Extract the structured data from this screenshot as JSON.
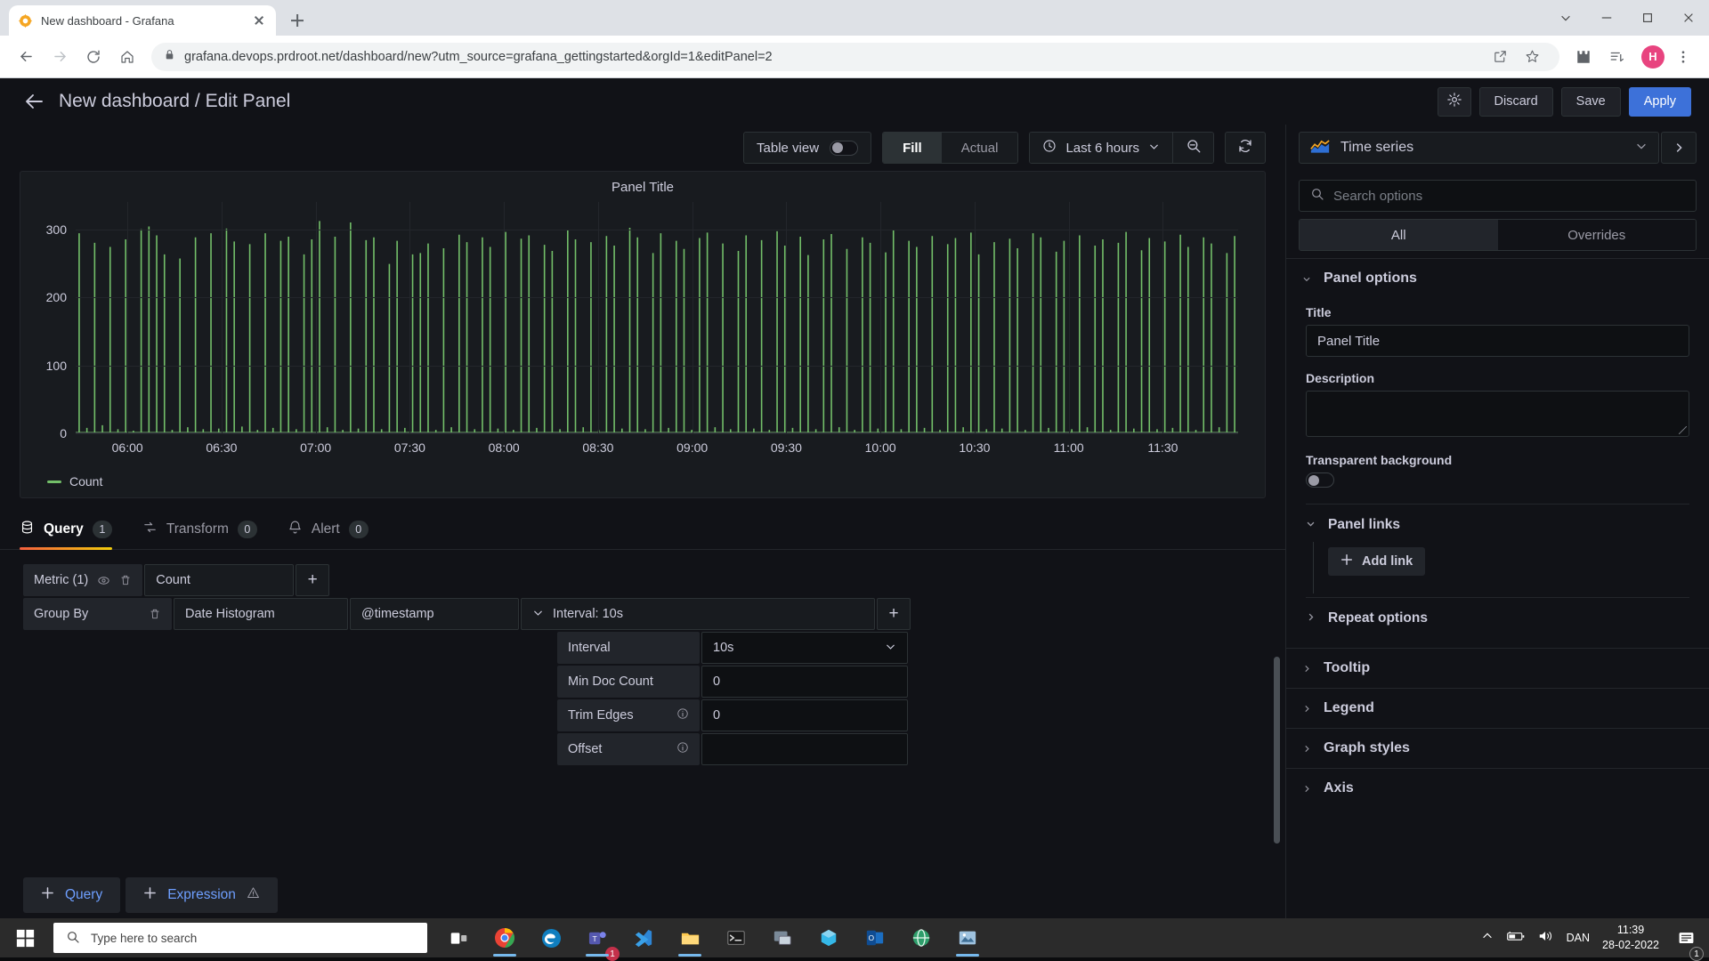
{
  "browser": {
    "tab": {
      "title": "New dashboard - Grafana",
      "favicon": "grafana-logo-icon"
    },
    "url": "grafana.devops.prdroot.net/dashboard/new?utm_source=grafana_gettingstarted&orgId=1&editPanel=2",
    "avatar_initial": "H",
    "new_tab_label": "+"
  },
  "header": {
    "title": "New dashboard / Edit Panel",
    "settings_icon": "gear-icon",
    "discard_label": "Discard",
    "save_label": "Save",
    "apply_label": "Apply"
  },
  "toolbar": {
    "table_view_label": "Table view",
    "table_view_on": false,
    "fill_label": "Fill",
    "actual_label": "Actual",
    "active_sizing": "Fill",
    "time_range": "Last 6 hours",
    "zoom_out_icon": "zoom-out-icon",
    "refresh_icon": "refresh-icon"
  },
  "panel": {
    "title": "Panel Title"
  },
  "chart_data": {
    "type": "bar",
    "title": "Panel Title",
    "xlabel": "",
    "ylabel": "",
    "ylim": [
      0,
      340
    ],
    "yticks": [
      0,
      100,
      200,
      300
    ],
    "xticks": [
      "06:00",
      "06:30",
      "07:00",
      "07:30",
      "08:00",
      "08:30",
      "09:00",
      "09:30",
      "10:00",
      "10:30",
      "11:00",
      "11:30"
    ],
    "grid": true,
    "legend": {
      "position": "bottom",
      "entries": [
        "Count"
      ]
    },
    "series": [
      {
        "name": "Count",
        "color": "#73bf69",
        "values": [
          294,
          8,
          280,
          12,
          274,
          6,
          285,
          4,
          300,
          304,
          291,
          263,
          5,
          257,
          9,
          288,
          6,
          294,
          7,
          301,
          282,
          10,
          278,
          5,
          294,
          8,
          283,
          289,
          6,
          263,
          285,
          312,
          9,
          289,
          5,
          310,
          7,
          284,
          288,
          6,
          249,
          283,
          8,
          263,
          265,
          279,
          5,
          272,
          9,
          292,
          281,
          6,
          288,
          274,
          7,
          296,
          5,
          286,
          291,
          8,
          277,
          268,
          6,
          299,
          285,
          9,
          281,
          5,
          290,
          276,
          7,
          302,
          288,
          6,
          265,
          294,
          8,
          283,
          271,
          5,
          287,
          295,
          9,
          279,
          6,
          268,
          291,
          7,
          284,
          5,
          297,
          276,
          8,
          289,
          262,
          6,
          285,
          293,
          9,
          271,
          5,
          288,
          280,
          7,
          266,
          299,
          6,
          283,
          274,
          8,
          290,
          5,
          278,
          287,
          9,
          295,
          263,
          6,
          281,
          7,
          286,
          272,
          5,
          294,
          288,
          8,
          267,
          283,
          6,
          291,
          9,
          276,
          285,
          5,
          280,
          296,
          7,
          269,
          287,
          6,
          282,
          8,
          292,
          274,
          5,
          288,
          279,
          9,
          265,
          290
        ]
      }
    ]
  },
  "query_tabs": [
    {
      "label": "Query",
      "badge": "1",
      "icon": "database-icon",
      "active": true
    },
    {
      "label": "Transform",
      "badge": "0",
      "icon": "transform-icon",
      "active": false
    },
    {
      "label": "Alert",
      "badge": "0",
      "icon": "bell-icon",
      "active": false
    }
  ],
  "query_editor": {
    "metric_label": "Metric (1)",
    "metric_value": "Count",
    "metric_add": "+",
    "metric_eye_icon": "eye-icon",
    "metric_trash_icon": "trash-icon",
    "groupby_label": "Group By",
    "groupby_trash_icon": "trash-icon",
    "groupby_type": "Date Histogram",
    "groupby_field": "@timestamp",
    "groupby_interval": "Interval: 10s",
    "groupby_add": "+",
    "settings": [
      {
        "label": "Interval",
        "value": "10s",
        "info": false,
        "dropdown": true
      },
      {
        "label": "Min Doc Count",
        "value": "0",
        "info": false,
        "dropdown": false
      },
      {
        "label": "Trim Edges",
        "value": "0",
        "info": true,
        "dropdown": false
      },
      {
        "label": "Offset",
        "value": "",
        "info": true,
        "dropdown": false
      }
    ],
    "add_query_label": "Query",
    "add_expression_label": "Expression",
    "expression_warn_icon": "warning-triangle-icon"
  },
  "options_pane": {
    "viz_type": "Time series",
    "viz_icon": "time-series-icon",
    "search_placeholder": "Search options",
    "search_value": "",
    "tabs": [
      {
        "label": "All",
        "active": true
      },
      {
        "label": "Overrides",
        "active": false
      }
    ],
    "panel_options": {
      "heading": "Panel options",
      "title_label": "Title",
      "title_value": "Panel Title",
      "description_label": "Description",
      "description_value": "",
      "transparent_label": "Transparent background",
      "transparent_on": false,
      "panel_links_heading": "Panel links",
      "add_link_label": "Add link",
      "repeat_options_heading": "Repeat options"
    },
    "sections": [
      {
        "label": "Tooltip"
      },
      {
        "label": "Legend"
      },
      {
        "label": "Graph styles"
      },
      {
        "label": "Axis"
      }
    ]
  },
  "taskbar": {
    "search_placeholder": "Type here to search",
    "language": "DAN",
    "time": "11:39",
    "date": "28-02-2022",
    "notification_count": "1",
    "apps": [
      "task-view-icon",
      "chrome-icon",
      "edge-icon",
      "teams-icon",
      "vscode-icon",
      "file-explorer-icon",
      "terminal-icon",
      "remote-desktop-icon",
      "photoshop-icon",
      "outlook-icon",
      "browser-icon",
      "image-viewer-icon"
    ]
  },
  "colors": {
    "accent": "#3d71d9",
    "series_green": "#73bf69",
    "tab_underline_start": "#f55f3e",
    "tab_underline_end": "#f2cc0c",
    "panel_bg": "#181b1f",
    "app_bg": "#111217"
  }
}
